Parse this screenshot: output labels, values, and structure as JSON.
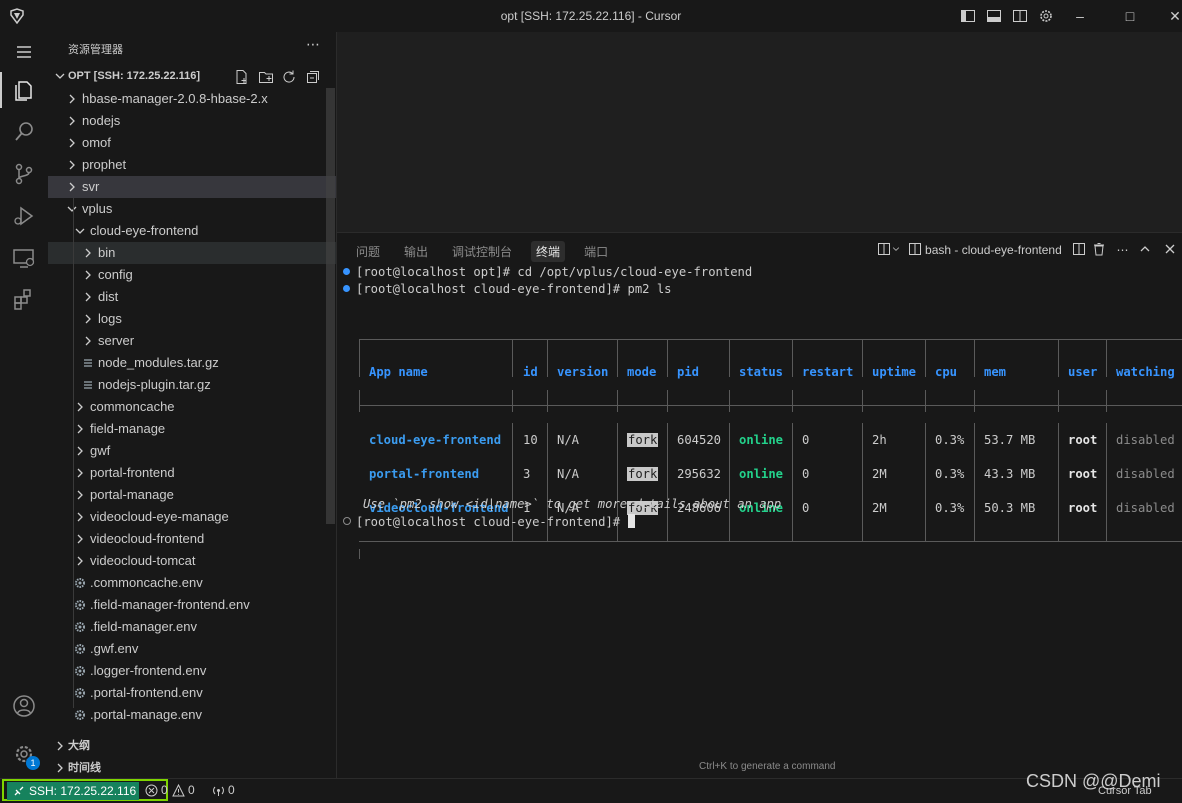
{
  "window": {
    "title": "opt [SSH: 172.25.22.116] - Cursor"
  },
  "activity_bar": {
    "icons": [
      "menu-icon",
      "explorer-icon",
      "search-icon",
      "source-control-icon",
      "run-debug-icon",
      "remote-explorer-icon",
      "extensions-icon",
      "account-icon",
      "settings-gear-icon"
    ],
    "badge": "1"
  },
  "explorer": {
    "header": "资源管理器",
    "section": "OPT [SSH: 172.25.22.116]",
    "items": [
      {
        "label": "hbase-manager-2.0.8-hbase-2.x",
        "depth": 0,
        "type": "folder",
        "open": false
      },
      {
        "label": "nodejs",
        "depth": 0,
        "type": "folder",
        "open": false
      },
      {
        "label": "omof",
        "depth": 0,
        "type": "folder",
        "open": false
      },
      {
        "label": "prophet",
        "depth": 0,
        "type": "folder",
        "open": false
      },
      {
        "label": "svr",
        "depth": 0,
        "type": "folder",
        "open": false,
        "state": "selected"
      },
      {
        "label": "vplus",
        "depth": 0,
        "type": "folder",
        "open": true
      },
      {
        "label": "cloud-eye-frontend",
        "depth": 1,
        "type": "folder",
        "open": true
      },
      {
        "label": "bin",
        "depth": 2,
        "type": "folder",
        "open": false,
        "state": "hover"
      },
      {
        "label": "config",
        "depth": 2,
        "type": "folder",
        "open": false
      },
      {
        "label": "dist",
        "depth": 2,
        "type": "folder",
        "open": false
      },
      {
        "label": "logs",
        "depth": 2,
        "type": "folder",
        "open": false
      },
      {
        "label": "server",
        "depth": 2,
        "type": "folder",
        "open": false
      },
      {
        "label": "node_modules.tar.gz",
        "depth": 2,
        "type": "archive"
      },
      {
        "label": "nodejs-plugin.tar.gz",
        "depth": 2,
        "type": "archive"
      },
      {
        "label": "commoncache",
        "depth": 1,
        "type": "folder",
        "open": false
      },
      {
        "label": "field-manage",
        "depth": 1,
        "type": "folder",
        "open": false
      },
      {
        "label": "gwf",
        "depth": 1,
        "type": "folder",
        "open": false
      },
      {
        "label": "portal-frontend",
        "depth": 1,
        "type": "folder",
        "open": false
      },
      {
        "label": "portal-manage",
        "depth": 1,
        "type": "folder",
        "open": false
      },
      {
        "label": "videocloud-eye-manage",
        "depth": 1,
        "type": "folder",
        "open": false
      },
      {
        "label": "videocloud-frontend",
        "depth": 1,
        "type": "folder",
        "open": false
      },
      {
        "label": "videocloud-tomcat",
        "depth": 1,
        "type": "folder",
        "open": false
      },
      {
        "label": ".commoncache.env",
        "depth": 1,
        "type": "env"
      },
      {
        "label": ".field-manager-frontend.env",
        "depth": 1,
        "type": "env"
      },
      {
        "label": ".field-manager.env",
        "depth": 1,
        "type": "env"
      },
      {
        "label": ".gwf.env",
        "depth": 1,
        "type": "env"
      },
      {
        "label": ".logger-frontend.env",
        "depth": 1,
        "type": "env"
      },
      {
        "label": ".portal-frontend.env",
        "depth": 1,
        "type": "env"
      },
      {
        "label": ".portal-manage.env",
        "depth": 1,
        "type": "env"
      }
    ],
    "outline": "大纲",
    "timeline": "时间线"
  },
  "panel": {
    "tabs": [
      "问题",
      "输出",
      "调试控制台",
      "终端",
      "端口"
    ],
    "active_tab": 3,
    "terminal_name": "bash - cloud-eye-frontend"
  },
  "terminal": {
    "line1": "[root@localhost opt]# cd /opt/vplus/cloud-eye-frontend",
    "line2": "[root@localhost cloud-eye-frontend]# pm2 ls",
    "headers": [
      "App name",
      "id",
      "version",
      "mode",
      "pid",
      "status",
      "restart",
      "uptime",
      "cpu",
      "mem",
      "user",
      "watching"
    ],
    "rows": [
      [
        "cloud-eye-frontend",
        "10",
        "N/A",
        "fork",
        "604520",
        "online",
        "0",
        "2h",
        "0.3%",
        "53.7 MB",
        "root",
        "disabled"
      ],
      [
        "portal-frontend",
        "3",
        "N/A",
        "fork",
        "295632",
        "online",
        "0",
        "2M",
        "0.3%",
        "43.3 MB",
        "root",
        "disabled"
      ],
      [
        "videocloud-frontend",
        "1",
        "N/A",
        "fork",
        "248606",
        "online",
        "0",
        "2M",
        "0.3%",
        "50.3 MB",
        "root",
        "disabled"
      ]
    ],
    "hint": "Use `pm2 show <id|name>` to get more details about an app",
    "prompt": "[root@localhost cloud-eye-frontend]# ",
    "ctrlk_hint": "Ctrl+K to generate a command"
  },
  "statusbar": {
    "ssh": "SSH: 172.25.22.116",
    "errors": "0",
    "warnings": "0",
    "ports": "0",
    "cursor_tab": "Cursor Tab"
  },
  "watermark": "CSDN @@Demi"
}
